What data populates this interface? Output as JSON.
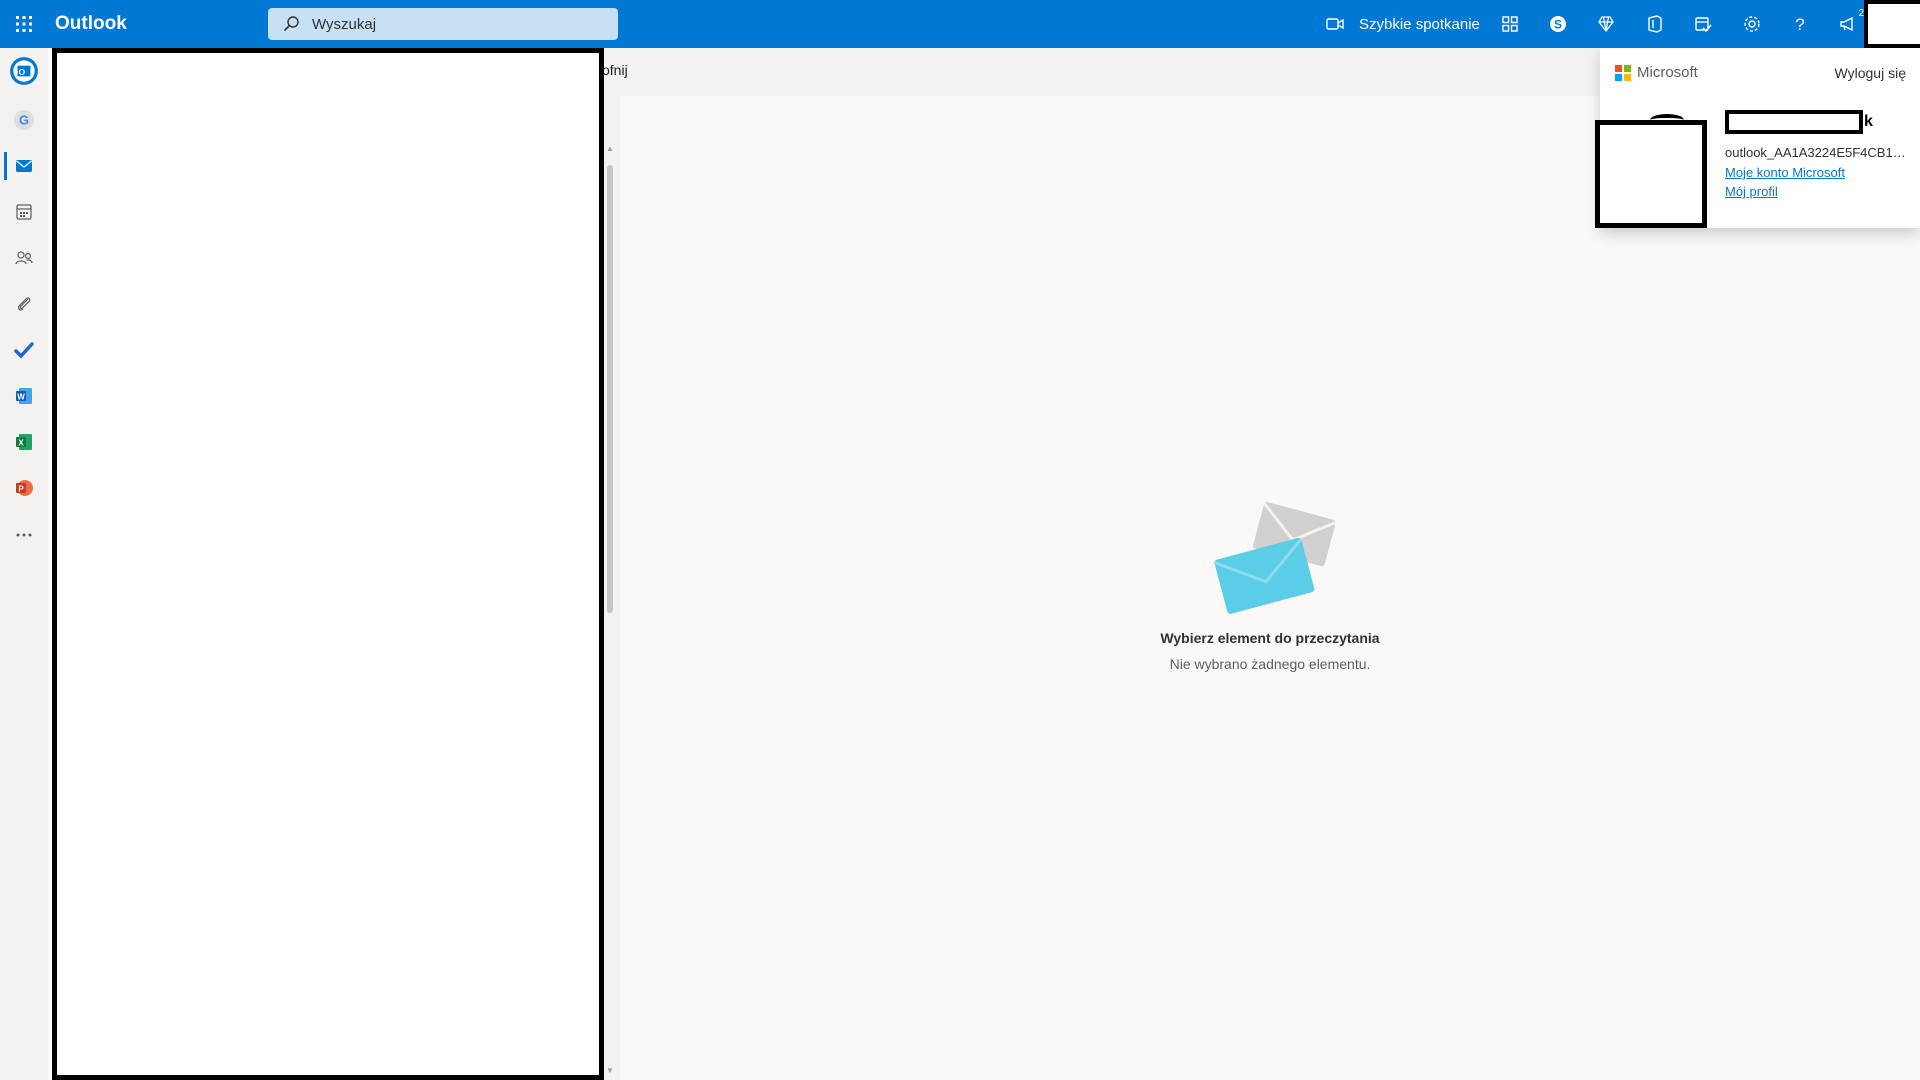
{
  "app": {
    "title": "Outlook",
    "accent": "#0078d4"
  },
  "search": {
    "placeholder": "Wyszukaj"
  },
  "topbar": {
    "meet_label": "Szybkie spotkanie",
    "notification_count": "2",
    "icons": [
      "waffle-icon",
      "video-icon",
      "apps-grid-icon",
      "skype-icon",
      "diamond-icon",
      "office-icon",
      "todo-icon",
      "gear-icon",
      "help-icon",
      "megaphone-icon"
    ]
  },
  "rail": {
    "items": [
      "outlook-account-icon",
      "google-account-icon",
      "mail-icon",
      "calendar-icon",
      "people-icon",
      "attachment-icon",
      "todo-check-icon",
      "word-icon",
      "excel-icon",
      "powerpoint-icon",
      "more-icon"
    ],
    "active": "mail-icon"
  },
  "command": {
    "partial_label": "ofnij"
  },
  "reading": {
    "empty_title": "Wybierz element do przeczytania",
    "empty_subtitle": "Nie wybrano żadnego elementu."
  },
  "account": {
    "brand": "Microsoft",
    "signout": "Wyloguj się",
    "name_tail": "k",
    "email": "outlook_AA1A3224E5F4CB17...",
    "link_account": "Moje konto Microsoft",
    "link_profile": "Mój profil"
  }
}
